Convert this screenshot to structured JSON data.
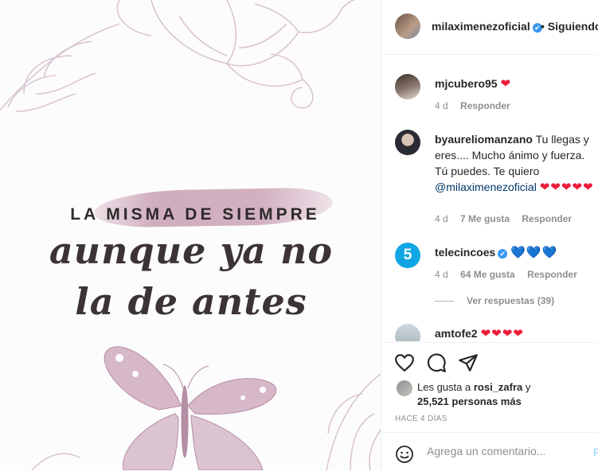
{
  "post": {
    "headline": "LA MISMA DE SIEMPRE",
    "script_line_1": "aunque ya no",
    "script_line_2": "la de antes"
  },
  "header": {
    "username": "milaximenezoficial",
    "verified": "✔",
    "follow_label": "• Siguiendo"
  },
  "comments": [
    {
      "username": "mjcubero95",
      "text": "",
      "hearts": "❤",
      "time": "4 d",
      "likes": "",
      "reply": "Responder"
    },
    {
      "username": "byaureliomanzano",
      "text": "Tu llegas y eres.... Mucho ánimo y fuerza. Tú puedes. Te quiero",
      "mention": "@milaximenezoficial",
      "hearts": "❤❤❤❤❤",
      "time": "4 d",
      "likes": "7 Me gusta",
      "reply": "Responder"
    },
    {
      "username": "telecincoes",
      "verified": "✔",
      "hearts": "💙💙💙",
      "time": "4 d",
      "likes": "64 Me gusta",
      "reply": "Responder",
      "view_replies": "Ver respuestas (39)"
    },
    {
      "username": "amtofe2",
      "hearts": "❤❤❤❤"
    }
  ],
  "icons": {
    "like": "heart-outline-icon",
    "comment": "speech-bubble-icon",
    "share": "paper-plane-icon",
    "emoji": "smiley-icon"
  },
  "likes": {
    "prefix": "Les gusta a",
    "user": "rosi_zafra",
    "connector": "y",
    "count": "25,521 personas más"
  },
  "timestamp": "HACE 4 DÍAS",
  "comment_box": {
    "placeholder": "Agrega un comentario...",
    "post_label": "P"
  },
  "colors": {
    "verified": "#3897f0",
    "heart_red": "#ed1c3a",
    "heart_blue": "#2e6ee0",
    "muted": "#8e8e8e",
    "mention": "#00376b"
  }
}
